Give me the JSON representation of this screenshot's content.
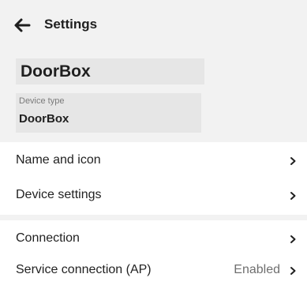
{
  "header": {
    "title": "Settings",
    "back_icon": "arrow-left-icon"
  },
  "device": {
    "name": "DoorBox",
    "type_label": "Device type",
    "type_value": "DoorBox"
  },
  "menu": {
    "group1": [
      {
        "label": "Name and icon",
        "value": ""
      },
      {
        "label": "Device settings",
        "value": ""
      }
    ],
    "group2": [
      {
        "label": "Connection",
        "value": ""
      },
      {
        "label": "Service connection (AP)",
        "value": "Enabled"
      }
    ]
  },
  "colors": {
    "background": "#f2f2f2",
    "card": "#ffffff",
    "field": "#e6e6e6",
    "text": "#1f1f1f",
    "muted": "#7a7a7a"
  }
}
